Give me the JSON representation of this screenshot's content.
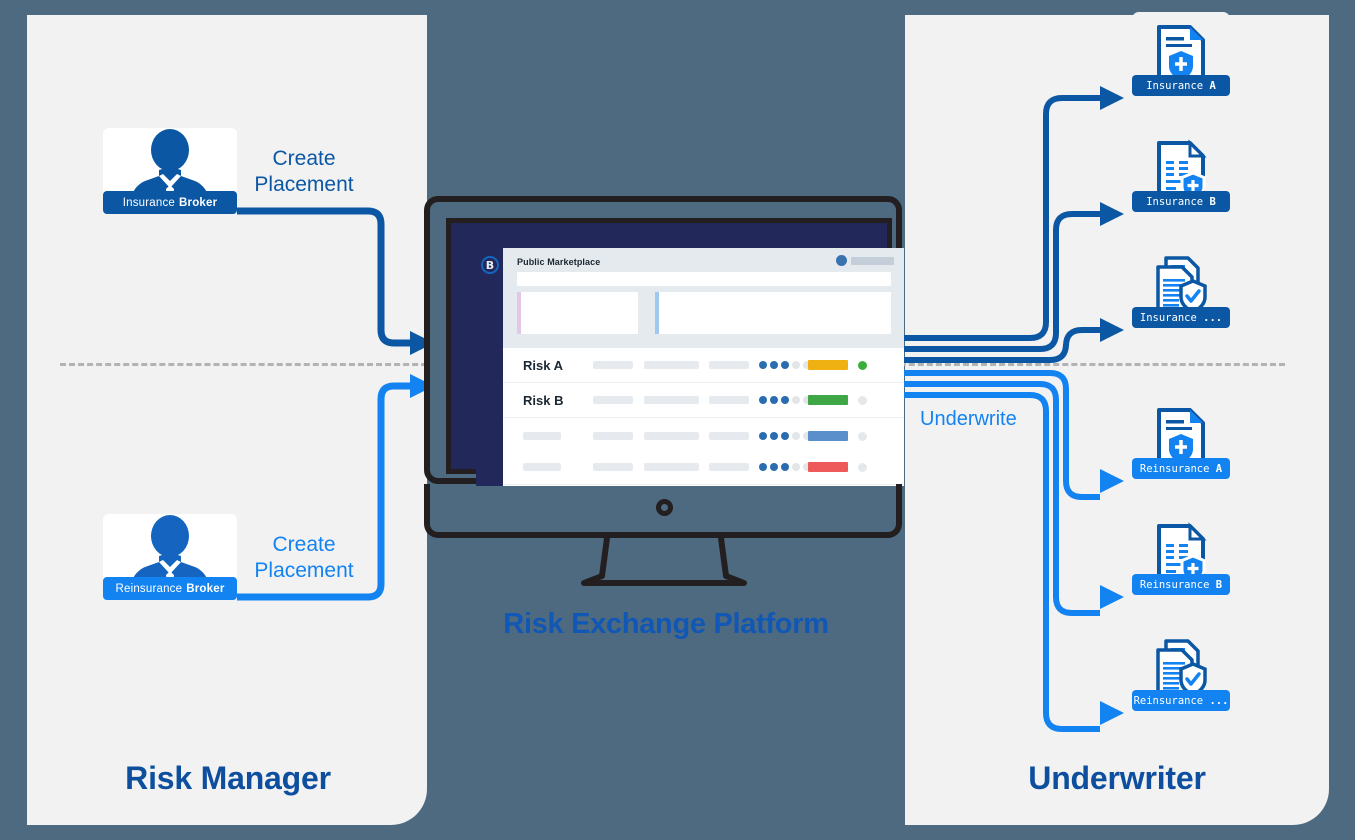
{
  "diagram": {
    "background_color": "#4d6a80",
    "panel_color": "#f2f2f2",
    "accent_dark_blue": "#0b57a4",
    "accent_bright_blue": "#1383f2",
    "title_color": "#0d4f9e"
  },
  "left_section": {
    "title": "Risk Manager",
    "brokers": [
      {
        "prefix": "Insurance",
        "bold": "Broker",
        "icon": "business-person-avatar-icon",
        "flow_label_line1": "Create",
        "flow_label_line2": "Placement",
        "color": "#0b57a4"
      },
      {
        "prefix": "Reinsurance",
        "bold": "Broker",
        "icon": "business-person-avatar-icon",
        "flow_label_line1": "Create",
        "flow_label_line2": "Placement",
        "color": "#1383f2"
      }
    ]
  },
  "center_section": {
    "title": "Risk Exchange Platform",
    "device": "desktop-monitor",
    "app": {
      "logo_glyph": "B",
      "header_title": "Public Marketplace",
      "search_placeholder": "",
      "kpi_cards": [
        {
          "accent": "#e3c7e8"
        },
        {
          "accent": "#9fc8ef"
        }
      ],
      "rows": [
        {
          "name": "Risk A",
          "rating_filled": 3,
          "rating_total": 5,
          "status_bar_color": "#eeb111",
          "status_dot_color": "#3aae3a"
        },
        {
          "name": "Risk B",
          "rating_filled": 3,
          "rating_total": 5,
          "status_bar_color": "#3fa745",
          "status_dot_color": "#e4e8eb"
        },
        {
          "name": "",
          "rating_filled": 3,
          "rating_total": 5,
          "status_bar_color": "#5b8fcb",
          "status_dot_color": "#e4e8eb"
        },
        {
          "name": "",
          "rating_filled": 3,
          "rating_total": 5,
          "status_bar_color": "#ee5a5a",
          "status_dot_color": "#e4e8eb"
        }
      ]
    }
  },
  "right_section": {
    "title": "Underwriter",
    "flow_label": "Underwrite",
    "documents": [
      {
        "prefix": "Insurance",
        "bold": "A",
        "icon": "document-shield-icon",
        "color": "#0b57a4"
      },
      {
        "prefix": "Insurance",
        "bold": "B",
        "icon": "document-list-shield-plus-icon",
        "color": "#0b57a4"
      },
      {
        "prefix": "Insurance",
        "bold": "...",
        "icon": "documents-shield-check-icon",
        "color": "#0b57a4"
      },
      {
        "prefix": "Reinsurance",
        "bold": "A",
        "icon": "document-shield-icon",
        "color": "#1383f2"
      },
      {
        "prefix": "Reinsurance",
        "bold": "B",
        "icon": "document-list-shield-plus-icon",
        "color": "#1383f2"
      },
      {
        "prefix": "Reinsurance",
        "bold": "...",
        "icon": "documents-shield-check-icon",
        "color": "#1383f2"
      }
    ]
  }
}
